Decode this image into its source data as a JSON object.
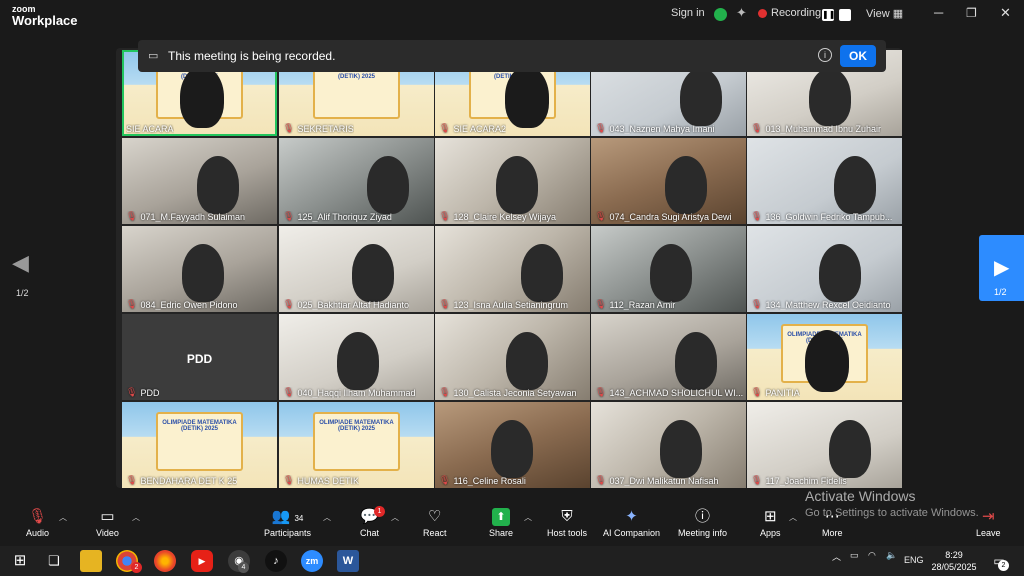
{
  "app": {
    "logo_line1": "zoom",
    "logo_line2": "Workplace",
    "sign_in": "Sign in",
    "recording": "Recording...",
    "view": "View"
  },
  "banner": {
    "text": "This meeting is being recorded.",
    "ok": "OK"
  },
  "paging": {
    "left": "1/2",
    "right": "1/2"
  },
  "tile_text": {
    "pdd_large": "PDD",
    "banner_title": "OLIMPIADE MATEMATIKA (DETIK) 2025"
  },
  "participants": [
    "SIE ACARA",
    "SEKRETARIS",
    "SIE ACARA2",
    "043_Naznen Mahya Imani",
    "013_Muhammad Ibnu Zuhair",
    "071_M.Fayyadh Sulaiman",
    "125_Alif Thoriquz Ziyad",
    "128_Claire Kelsey Wijaya",
    "074_Candra Sugi Aristya Dewi",
    "136_Goldwin Fedriko Tampub...",
    "084_Edric Owen Pidono",
    "025_Bakhtiar Altaf Hadianto",
    "123_Isna Aulia Setianingrum",
    "112_Razan Amir",
    "134_Matthew Rexcel Oeidianto",
    "PDD",
    "040_Haqqi Ilham Muhammad",
    "130_Calista Jeconia Setyawan",
    "143_ACHMAD SHOLICHUL WI...",
    "PANITIA",
    "BENDAHARA DET K 25",
    "HUMAS DETIK",
    "116_Celine Rosali",
    "037_Dwi Malikatun Nafisah",
    "117_Joachim Fidelis"
  ],
  "toolbar": {
    "audio": "Audio",
    "video": "Video",
    "participants": "Participants",
    "participants_count": "34",
    "chat": "Chat",
    "chat_badge": "1",
    "react": "React",
    "share": "Share",
    "host_tools": "Host tools",
    "ai_companion": "AI Companion",
    "meeting_info": "Meeting info",
    "apps": "Apps",
    "more": "More",
    "leave": "Leave"
  },
  "watermark": {
    "line1": "Activate Windows",
    "line2": "Go to Settings to activate Windows."
  },
  "taskbar": {
    "lang": "ENG",
    "time": "8:29",
    "date": "28/05/2025",
    "notif_count": "2",
    "chrome_badge": "2",
    "app_badge": "4",
    "zoom_label": "zm",
    "word_label": "W"
  },
  "colors": {
    "accent": "#0e72ed",
    "active_speaker": "#22c55e",
    "muted": "#e04a4a",
    "nav_blue": "#2d8cff"
  }
}
